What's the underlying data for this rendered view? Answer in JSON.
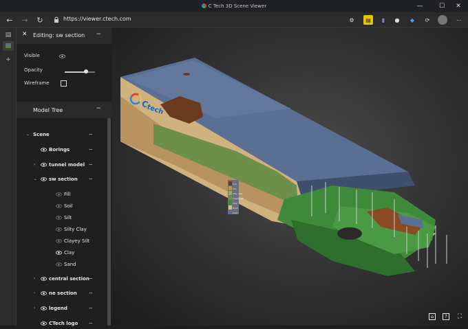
{
  "window": {
    "title": "C Tech 3D Scene Viewer"
  },
  "browser": {
    "url": "https://viewer.ctech.com"
  },
  "panel": {
    "header": "Editing: sw section",
    "visible_label": "Visible",
    "opacity_label": "Opacity",
    "opacity_value": 0.7,
    "wireframe_label": "Wireframe",
    "model_tree_label": "Model Tree",
    "more_glyph": "..."
  },
  "tree": {
    "items": [
      {
        "label": "Scene"
      },
      {
        "label": "Borings"
      },
      {
        "label": "tunnel model"
      },
      {
        "label": "sw section"
      },
      {
        "label": "Fill"
      },
      {
        "label": "Soil"
      },
      {
        "label": "Silt"
      },
      {
        "label": "Silty Clay"
      },
      {
        "label": "Clayey Silt"
      },
      {
        "label": "Clay"
      },
      {
        "label": "Sand"
      },
      {
        "label": "central section"
      },
      {
        "label": "ne section"
      },
      {
        "label": "legend"
      },
      {
        "label": "CTech logo"
      }
    ]
  },
  "scene": {
    "logo_letter": "C",
    "logo_text": "tech",
    "legend_entries": [
      "Soil",
      "Silt",
      "Silty_Clay",
      "Clayey_Silt",
      "Clay",
      "Sand",
      "Core"
    ]
  },
  "colors": {
    "accent": "#4aa3df",
    "top_surface": "#5b6f95",
    "soil_brown": "#6b3a1e",
    "sand": "#d8c08a",
    "green": "#3e8a3a"
  }
}
